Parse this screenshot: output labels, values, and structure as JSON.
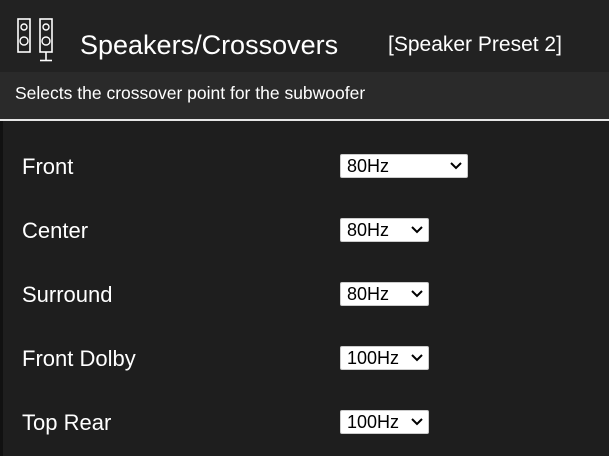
{
  "header": {
    "title": "Speakers/Crossovers",
    "preset": "[Speaker Preset 2]",
    "icon": "speakers-icon"
  },
  "description": "Selects the crossover point for the subwoofer",
  "rows": [
    {
      "label": "Front",
      "value": "80Hz"
    },
    {
      "label": "Center",
      "value": "80Hz"
    },
    {
      "label": "Surround",
      "value": "80Hz"
    },
    {
      "label": "Front Dolby",
      "value": "100Hz"
    },
    {
      "label": "Top Rear",
      "value": "100Hz"
    }
  ],
  "colors": {
    "background": "#222222",
    "content_background": "#1e1e1e",
    "divider": "#e6e6e6",
    "text": "#ffffff"
  }
}
